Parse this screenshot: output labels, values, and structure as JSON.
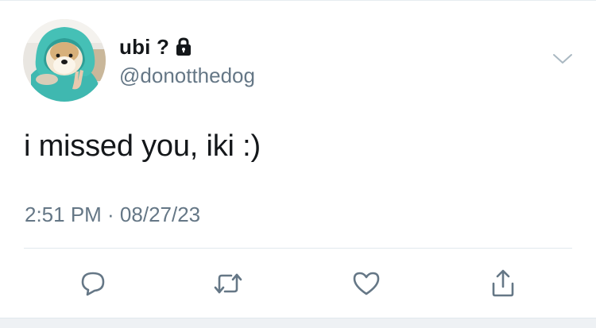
{
  "tweet": {
    "author": {
      "display_name": "ubi ?",
      "handle": "@donotthedog",
      "protected_icon": "lock-icon",
      "avatar": "dog-in-hoodie-avatar"
    },
    "text": "i missed you, iki :)",
    "timestamp": "2:51 PM · 08/27/23",
    "menu_icon": "chevron-down-icon"
  },
  "actions": [
    {
      "name": "reply",
      "icon": "speech-bubble-icon"
    },
    {
      "name": "retweet",
      "icon": "retweet-arrows-icon"
    },
    {
      "name": "like",
      "icon": "heart-icon"
    },
    {
      "name": "share",
      "icon": "share-upload-icon"
    }
  ],
  "colors": {
    "text_primary": "#14171a",
    "text_secondary": "#657786",
    "icon": "#657786",
    "divider": "#e1e8ed",
    "avatar_hoodie": "#3fb8b0"
  }
}
